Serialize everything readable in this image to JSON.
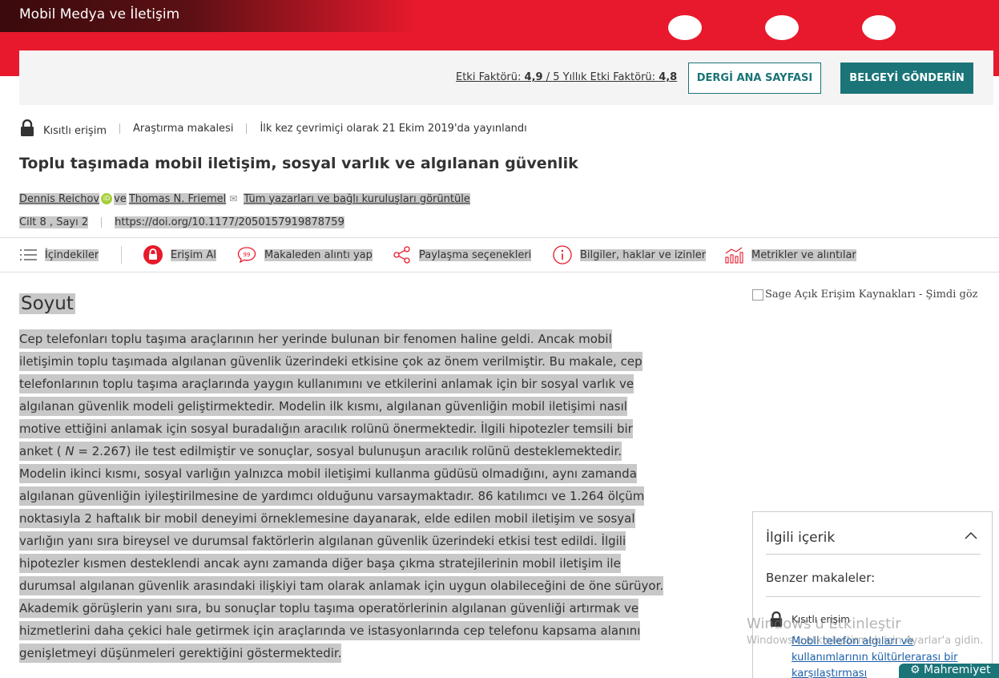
{
  "header": {
    "journal": "Mobil Medya ve İletişim",
    "impact_label": "Etki Faktörü:",
    "impact_value": "4,9",
    "impact_sep": " / ",
    "five_year_label": "5 Yıllık Etki Faktörü:",
    "five_year_value": "4,8",
    "home_button": "DERGİ ANA SAYFASI",
    "submit_button": "BELGEYİ GÖNDERİN",
    "brand_color": "#e8192c",
    "accent_color": "#1a7478"
  },
  "meta": {
    "access": "Kısıtlı erişim",
    "type": "Araştırma makalesi",
    "published": "İlk kez çevrimiçi olarak 21 Ekim 2019'da yayınlandı"
  },
  "article": {
    "title": "Toplu taşımada mobil iletişim, sosyal varlık ve algılanan güvenlik",
    "author1": "Dennis Reichov",
    "orcid": "iD",
    "and": "ve",
    "author2": "Thomas N. Friemel",
    "view_all": "Tüm yazarları ve bağlı kuruluşları görüntüle",
    "issue": "Cilt 8 , Sayı 2",
    "doi": "https://doi.org/10.1177/2050157919878759"
  },
  "toolbar": {
    "contents": "İçindekiler",
    "access": "Erişim Al",
    "cite": "Makaleden alıntı yap",
    "share": "Paylaşma seçenekleri",
    "info": "Bilgiler, haklar ve izinler",
    "metrics": "Metrikler ve alıntılar"
  },
  "abstract": {
    "heading": "Soyut",
    "p1": "Cep telefonları toplu taşıma araçlarının her yerinde bulunan bir fenomen haline geldi. Ancak mobil iletişimin toplu taşımada algılanan güvenlik üzerindeki etkisine çok az önem verilmiştir. Bu makale, cep telefonlarının toplu taşıma araçlarında yaygın kullanımını ve etkilerini anlamak için bir sosyal varlık ve algılanan güvenlik modeli geliştirmektedir. Modelin ilk kısmı, algılanan güvenliğin mobil iletişimi nasıl motive ettiğini anlamak için sosyal buradalığın aracılık rolünü önermektedir. İlgili hipotezler temsili bir anket ( ",
    "n_var": "N",
    "p2": " = 2.267) ile test edilmiştir ve sonuçlar, sosyal bulunuşun aracılık rolünü desteklemektedir. Modelin ikinci kısmı, sosyal varlığın yalnızca mobil iletişimi kullanma güdüsü olmadığını, aynı zamanda algılanan güvenliğin iyileştirilmesine de yardımcı olduğunu varsaymaktadır. 86 katılımcı ve 1.264 ölçüm noktasıyla 2 haftalık bir mobil deneyimi örneklemesine dayanarak, elde edilen mobil iletişim ve sosyal varlığın yanı sıra bireysel ve durumsal faktörlerin algılanan güvenlik üzerindeki etkisi test edildi. İlgili hipotezler kısmen desteklendi ancak aynı zamanda diğer başa çıkma stratejilerinin mobil iletişim ile durumsal algılanan güvenlik arasındaki ilişkiyi tam olarak anlamak için uygun olabileceğini de öne sürüyor. Akademik görüşlerin yanı sıra, bu sonuçlar toplu taşıma operatörlerinin algılanan güvenliği artırmak ve hizmetlerini daha çekici hale getirmek için araçlarında ve istasyonlarında cep telefonu kapsama alanını genişletmeyi düşünmeleri gerektiğini göstermektedir."
  },
  "sidebar": {
    "ad_alt": "Sage Açık Erişim Kaynakları - Şimdi göz",
    "related_heading": "İlgili içerik",
    "similar": "Benzer makaleler:",
    "item_access": "Kısıtlı erişim",
    "item_link": "Mobil telefon algıları ve kullanımlarının kültürlerarası bir karşılaştırması"
  },
  "overlay": {
    "windows_title": "Windows'u Etkinleştir",
    "windows_sub": "Windows'u etkinleştirmek için Ayarlar'a gidin.",
    "privacy": "Mahremiyet"
  }
}
